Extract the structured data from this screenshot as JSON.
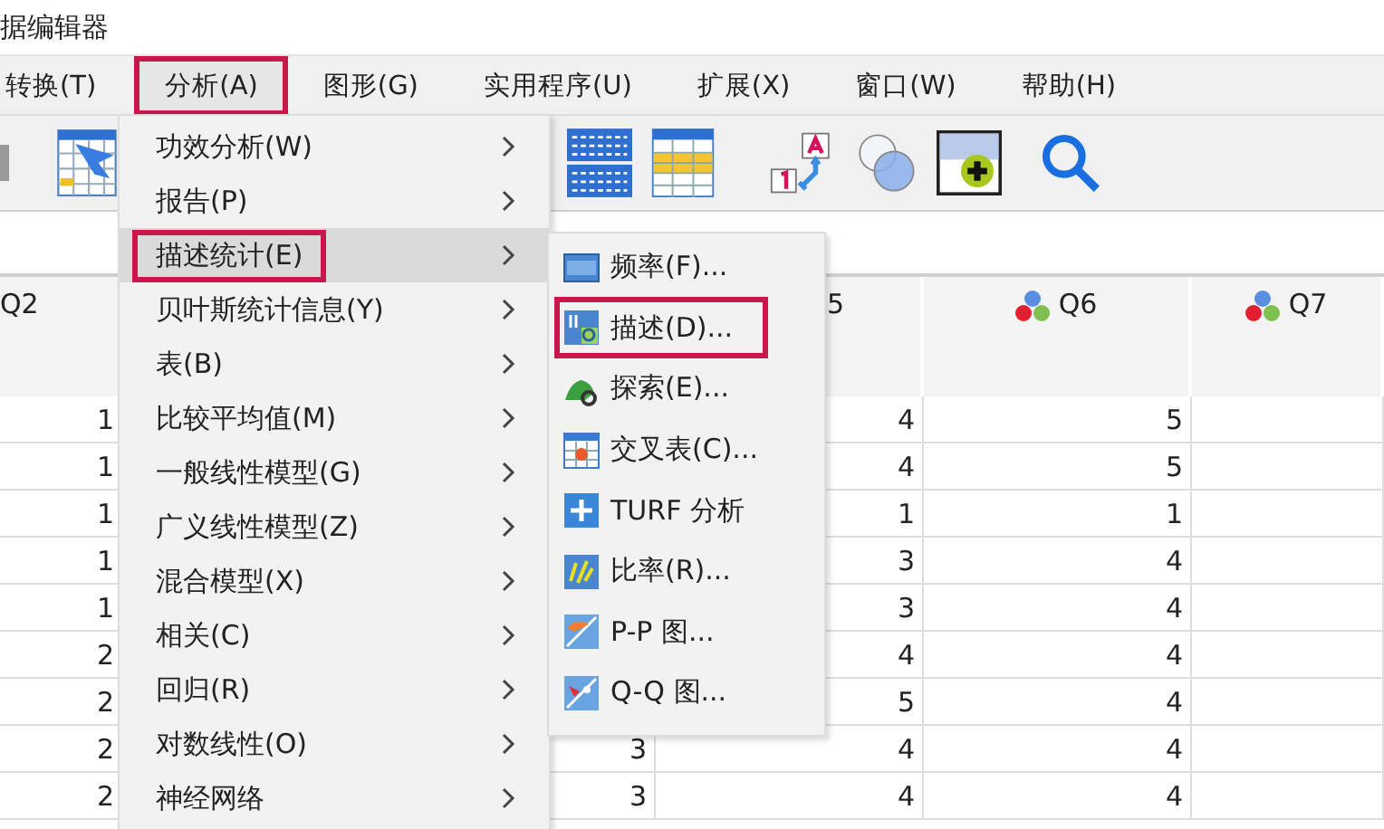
{
  "window": {
    "title": "据编辑器"
  },
  "menu_bar": [
    {
      "label": "转换(T)",
      "highlighted": false
    },
    {
      "label": "分析(A)",
      "highlighted": true
    },
    {
      "label": "图形(G)",
      "highlighted": false
    },
    {
      "label": "实用程序(U)",
      "highlighted": false
    },
    {
      "label": "扩展(X)",
      "highlighted": false
    },
    {
      "label": "窗口(W)",
      "highlighted": false
    },
    {
      "label": "帮助(H)",
      "highlighted": false
    }
  ],
  "toolbar": [
    {
      "kind": "partial"
    },
    {
      "kind": "goto"
    },
    {
      "kind": "gap"
    },
    {
      "kind": "variables"
    },
    {
      "kind": "cases"
    },
    {
      "kind": "labels"
    },
    {
      "kind": "sets"
    },
    {
      "kind": "insert"
    },
    {
      "kind": "search"
    }
  ],
  "table": {
    "columns": [
      {
        "header": "Q2",
        "icon": false
      },
      {},
      {},
      {
        "header": "5",
        "icon": false
      },
      {
        "header": "Q6",
        "icon": true
      },
      {
        "header": "Q7",
        "icon": true
      }
    ],
    "rows": [
      {
        "cells": [
          "1",
          null,
          null,
          "4",
          "5",
          null
        ]
      },
      {
        "cells": [
          "1",
          null,
          null,
          "4",
          "5",
          null
        ]
      },
      {
        "cells": [
          "1",
          null,
          null,
          "1",
          "1",
          null
        ]
      },
      {
        "cells": [
          "1",
          null,
          null,
          "3",
          "4",
          null
        ]
      },
      {
        "cells": [
          "1",
          null,
          null,
          "3",
          "4",
          null
        ]
      },
      {
        "cells": [
          "2",
          null,
          null,
          "4",
          "4",
          null
        ]
      },
      {
        "cells": [
          "2",
          null,
          null,
          "5",
          "4",
          null
        ]
      },
      {
        "cells": [
          "2",
          null,
          "3",
          "4",
          "4",
          null
        ]
      },
      {
        "cells": [
          "2",
          null,
          "3",
          "4",
          "4",
          null
        ]
      }
    ]
  },
  "analyze_menu": {
    "items": [
      {
        "label": "功效分析(W)",
        "selected": false,
        "highlighted": false
      },
      {
        "label": "报告(P)",
        "selected": false,
        "highlighted": false
      },
      {
        "label": "描述统计(E)",
        "selected": true,
        "highlighted": true
      },
      {
        "label": "贝叶斯统计信息(Y)",
        "selected": false,
        "highlighted": false
      },
      {
        "label": "表(B)",
        "selected": false,
        "highlighted": false
      },
      {
        "label": "比较平均值(M)",
        "selected": false,
        "highlighted": false
      },
      {
        "label": "一般线性模型(G)",
        "selected": false,
        "highlighted": false
      },
      {
        "label": "广义线性模型(Z)",
        "selected": false,
        "highlighted": false
      },
      {
        "label": "混合模型(X)",
        "selected": false,
        "highlighted": false
      },
      {
        "label": "相关(C)",
        "selected": false,
        "highlighted": false
      },
      {
        "label": "回归(R)",
        "selected": false,
        "highlighted": false
      },
      {
        "label": "对数线性(O)",
        "selected": false,
        "highlighted": false
      },
      {
        "label": "神经网络",
        "selected": false,
        "highlighted": false
      }
    ]
  },
  "descriptives_submenu": {
    "items": [
      {
        "label": "频率(F)...",
        "kind": "frequencies",
        "highlighted": false
      },
      {
        "label": "描述(D)...",
        "kind": "descriptives",
        "highlighted": true
      },
      {
        "label": "探索(E)...",
        "kind": "explore",
        "highlighted": false
      },
      {
        "label": "交叉表(C)...",
        "kind": "crosstabs",
        "highlighted": false
      },
      {
        "label": "TURF 分析",
        "kind": "turf",
        "highlighted": false
      },
      {
        "label": "比率(R)...",
        "kind": "ratio",
        "highlighted": false
      },
      {
        "label": "P-P 图...",
        "kind": "pp",
        "highlighted": false
      },
      {
        "label": "Q-Q 图...",
        "kind": "qq",
        "highlighted": false
      }
    ]
  }
}
